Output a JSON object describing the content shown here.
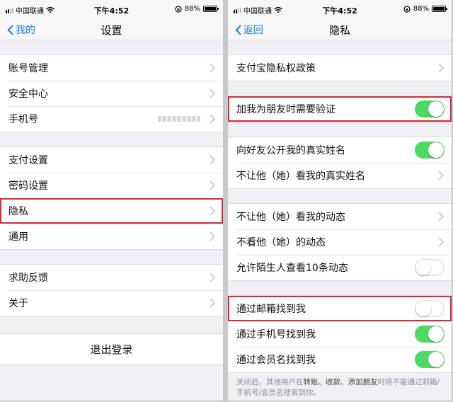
{
  "status": {
    "carrier": "中国联通",
    "time": "下午4:52",
    "battery": "88%"
  },
  "left": {
    "title": "设置",
    "back": "我的",
    "groups": [
      [
        "账号管理",
        "安全中心",
        "手机号"
      ],
      [
        "支付设置",
        "密码设置",
        "隐私",
        "通用"
      ],
      [
        "求助反馈",
        "关于"
      ]
    ],
    "phone_value_hidden": true,
    "logout": "退出登录"
  },
  "right": {
    "title": "隐私",
    "back": "返回",
    "policy": "支付宝隐私权政策",
    "verify": {
      "label": "加我为朋友时需要验证",
      "on": true
    },
    "realname_public": {
      "label": "向好友公开我的真实姓名",
      "on": true
    },
    "hide_realname": "不让他（她）看我的真实姓名",
    "hide_feed": "不让他（她）看我的动态",
    "ignore_feed": "不看他（她）的动态",
    "stranger_feed": {
      "label": "允许陌生人查看10条动态",
      "on": false
    },
    "find_email": {
      "label": "通过邮箱找到我",
      "on": false
    },
    "find_phone": {
      "label": "通过手机号找到我",
      "on": true
    },
    "find_member": {
      "label": "通过会员名找到我",
      "on": true
    },
    "note_a": "关闭后，其他用户在",
    "note_b": "转账、收款、添加朋友",
    "note_c": "时将不能通过邮箱/手机号/会员名搜索到你。"
  },
  "colors": {
    "toggle_on": "#4cd964",
    "highlight": "#d32d3a",
    "link": "#1478f5"
  }
}
